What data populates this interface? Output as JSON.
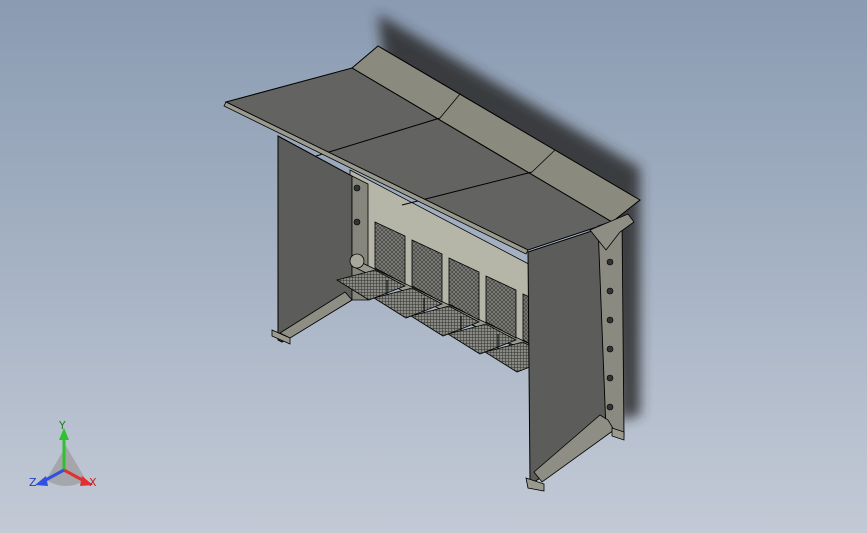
{
  "viewport": {
    "background_top": "#8a9bb2",
    "background_bottom": "#c3cad6"
  },
  "model": {
    "kind": "bus-shelter-bench",
    "face_color": "#5e5e5c",
    "roof_color": "#636361",
    "top_face_color": "#8a8a7e",
    "edge_color": "#000000",
    "shadow_color": "#2b2b2b",
    "seat_count": 5
  },
  "triad": {
    "x_label": "X",
    "y_label": "Y",
    "z_label": "Z",
    "x_color": "#e03030",
    "y_color": "#30c030",
    "z_color": "#3050e0"
  }
}
